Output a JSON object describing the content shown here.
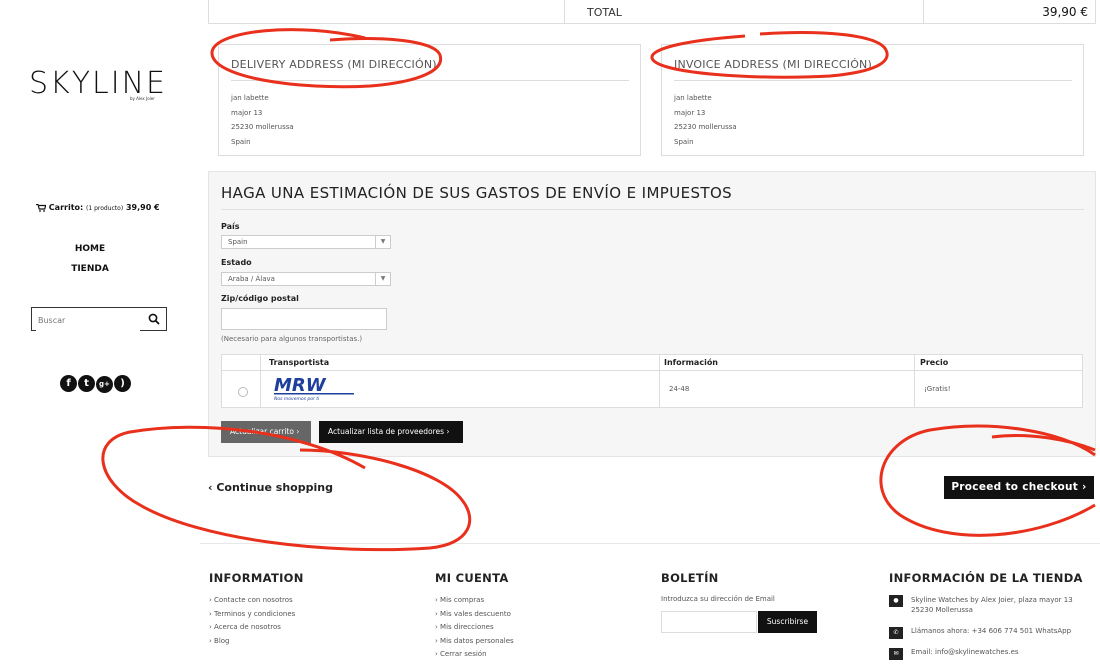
{
  "brand": {
    "logo": "SKYLINE",
    "logo_sub": "by Alex Joier"
  },
  "sidebar": {
    "cart_label": "Carrito:",
    "cart_count": "(1 producto)",
    "cart_total": "39,90 €",
    "nav": [
      "HOME",
      "TIENDA"
    ],
    "search_placeholder": "Buscar",
    "socials": [
      "facebook-icon",
      "twitter-icon",
      "google-plus-icon",
      "rss-icon"
    ]
  },
  "totals": {
    "label": "TOTAL",
    "value": "39,90 €"
  },
  "delivery": {
    "title": "DELIVERY ADDRESS (MI DIRECCIÓN)",
    "lines": [
      "jan labette",
      "major 13",
      "25230 mollerussa",
      "Spain"
    ]
  },
  "invoice": {
    "title": "INVOICE ADDRESS (MI DIRECCIÓN)",
    "lines": [
      "jan labette",
      "major 13",
      "25230 mollerussa",
      "Spain"
    ]
  },
  "estimate": {
    "title": "HAGA UNA ESTIMACIÓN DE SUS GASTOS DE ENVÍO E IMPUESTOS",
    "country_label": "País",
    "country_value": "Spain",
    "state_label": "Estado",
    "state_value": "Araba / Álava",
    "zip_label": "Zip/código postal",
    "zip_value": "",
    "zip_hint": "(Necesario para algunos transportistas.)",
    "carrier_headers": [
      "Transportista",
      "Información",
      "Precio"
    ],
    "carrier_logo": "MRW",
    "carrier_tagline": "Nos movemos por ti",
    "carrier_info": "24-48",
    "carrier_price": "¡Gratis!",
    "update_cart": "Actualizar carrito ›",
    "update_carriers": "Actualizar lista de proveedores ›"
  },
  "actions": {
    "continue": "‹ Continue shopping",
    "checkout": "Proceed to checkout ›"
  },
  "footer": {
    "info_title": "INFORMATION",
    "info_links": [
      "› Contacte con nosotros",
      "› Terminos y condiciones",
      "› Acerca de nosotros",
      "› Blog"
    ],
    "account_title": "MI CUENTA",
    "account_links": [
      "› Mis compras",
      "› Mis vales descuento",
      "› Mis direcciones",
      "› Mis datos personales",
      "› Cerrar sesión"
    ],
    "newsletter_title": "BOLETÍN",
    "newsletter_text": "Introduzca su dirección de Email",
    "newsletter_button": "Suscribirse",
    "store_title": "INFORMACIÓN DE LA TIENDA",
    "store_address": "Skyline Watches by Alex Joier, plaza mayor 13",
    "store_address2": "25230 Mollerussa",
    "store_phone": "Llámanos ahora: +34 606 774 501 WhatsApp",
    "store_email": "Email: info@skylinewatches.es"
  },
  "colors": {
    "annotation": "#e8301c",
    "dark_button": "#111111"
  }
}
